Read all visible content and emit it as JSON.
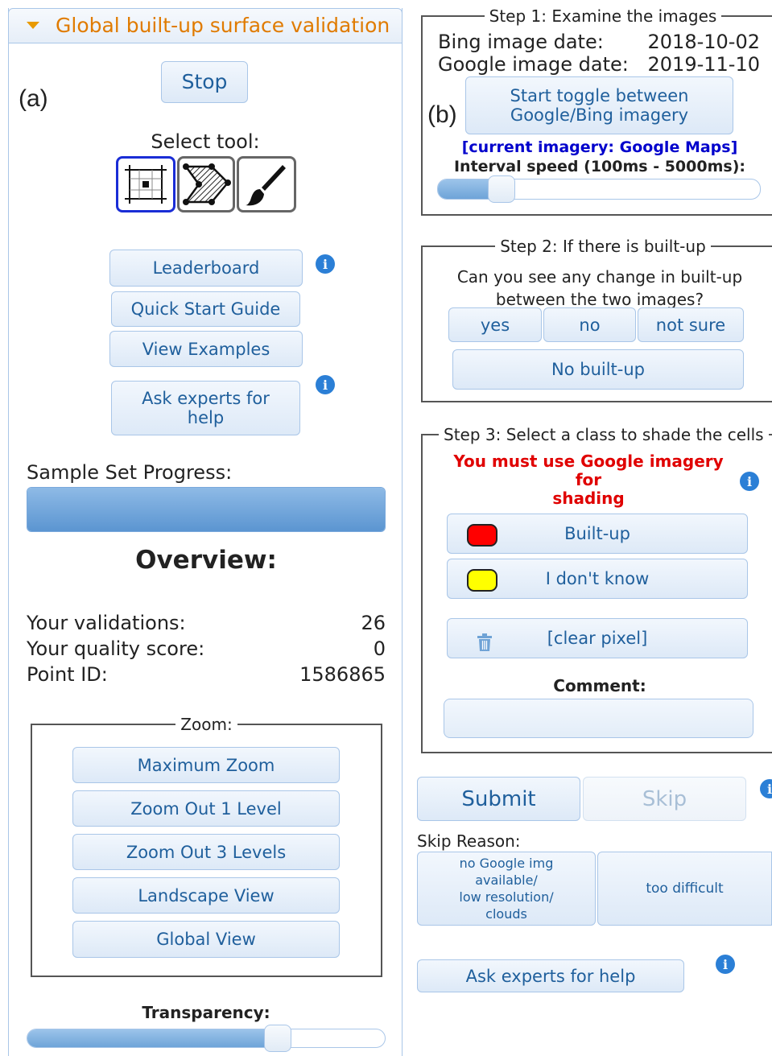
{
  "left": {
    "header_title": "Global built-up surface validation",
    "panel_label": "(a)",
    "stop_label": "Stop",
    "select_tool_label": "Select tool:",
    "tools": [
      "grid-cell-icon",
      "polygon-icon",
      "brush-icon"
    ],
    "leaderboard_label": "Leaderboard",
    "quick_start_label": "Quick Start Guide",
    "view_examples_label": "View Examples",
    "ask_experts_label_1": "Ask experts for",
    "ask_experts_label_2": "help",
    "progress_label": "Sample Set Progress:",
    "progress_value": 1.0,
    "overview_title": "Overview:",
    "stats": [
      {
        "label": "Your validations:",
        "value": "26"
      },
      {
        "label": "Your quality score:",
        "value": "0"
      },
      {
        "label": "Point ID:",
        "value": "1586865"
      }
    ],
    "zoom_legend": "Zoom:",
    "zoom_buttons": [
      "Maximum Zoom",
      "Zoom Out 1 Level",
      "Zoom Out 3 Levels",
      "Landscape View",
      "Global View"
    ],
    "transparency_label": "Transparency:",
    "transparency_value": 0.7
  },
  "right": {
    "panel_label": "(b)",
    "step1_legend": "Step 1: Examine the images",
    "bing_label": "Bing image date:",
    "bing_date": "2018-10-02",
    "google_label": "Google image date:",
    "google_date": "2019-11-10",
    "toggle_line1": "Start toggle between",
    "toggle_line2": "Google/Bing imagery",
    "current_imagery": "[current imagery: Google Maps]",
    "interval_label": "Interval speed (100ms - 5000ms):",
    "interval_value": 0.2,
    "step2_legend": "Step 2: If there is built-up",
    "question_line1": "Can you see any change in built-up",
    "question_line2": "between the two images?",
    "yes_label": "yes",
    "no_label": "no",
    "not_sure_label": "not sure",
    "no_builtup_label": "No built-up",
    "step3_legend": "Step 3: Select a class to shade the cells",
    "warning_line1": "You must use Google imagery for",
    "warning_line2": "shading",
    "classes": [
      {
        "label": "Built-up",
        "color": "#ff0000"
      },
      {
        "label": "I don't know",
        "color": "#ffff00"
      }
    ],
    "clear_label": "[clear pixel]",
    "comment_label": "Comment:",
    "submit_label": "Submit",
    "skip_label": "Skip",
    "skip_reason_label": "Skip Reason:",
    "skip_reason_1": [
      "no Google img",
      "available/",
      "low resolution/",
      "clouds"
    ],
    "skip_reason_2": "too difficult",
    "ask_experts_label": "Ask experts for help"
  },
  "colors": {
    "accent": "#1f5f9c",
    "header_text": "#e07b00",
    "warning": "#e00000",
    "current_imagery": "#0000cc",
    "info": "#2b7fd6"
  }
}
